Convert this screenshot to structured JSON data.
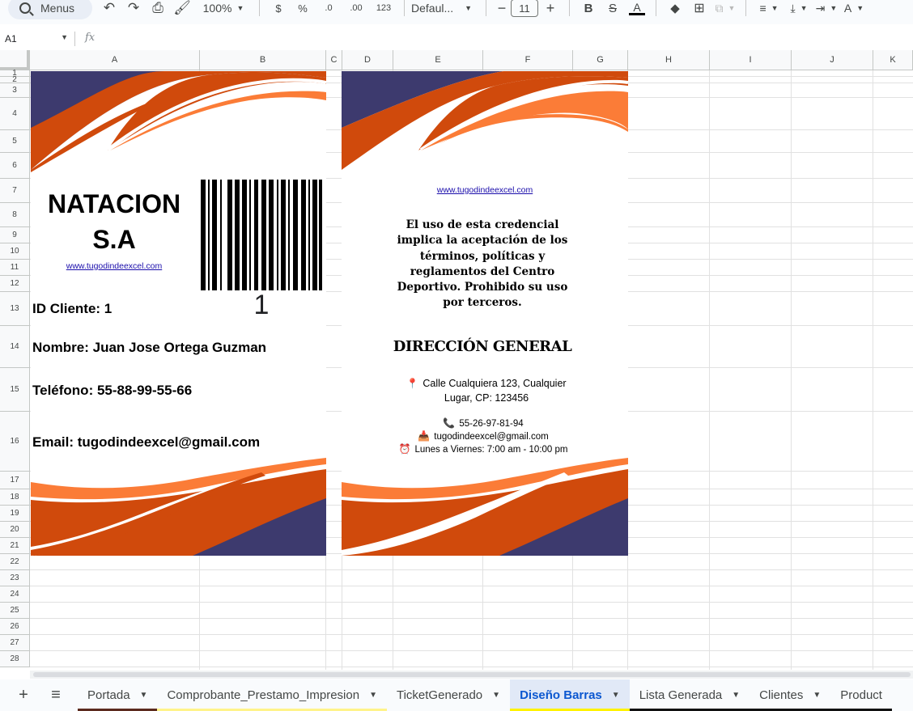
{
  "toolbar": {
    "search_label": "Menus",
    "zoom": "100%",
    "currency": "$",
    "percent": "%",
    "decrease_decimal": ".0",
    "increase_decimal": ".00",
    "number_format": "123",
    "font_name": "Defaul...",
    "font_size": "11",
    "minus": "−",
    "plus": "+",
    "bold": "B",
    "text_color_letter": "A",
    "text_color": "#000000"
  },
  "formula_bar": {
    "cell_ref": "A1",
    "fx": "fx",
    "value": ""
  },
  "columns": [
    "A",
    "B",
    "C",
    "D",
    "E",
    "F",
    "G",
    "H",
    "I",
    "J",
    "K"
  ],
  "rows": [
    "1",
    "2",
    "3",
    "4",
    "5",
    "6",
    "7",
    "8",
    "9",
    "10",
    "11",
    "12",
    "13",
    "14",
    "15",
    "16",
    "17",
    "18",
    "19",
    "20",
    "21",
    "22",
    "23",
    "24",
    "25",
    "26",
    "27",
    "28"
  ],
  "card_front": {
    "title_line1": "NATACION",
    "title_line2": "S.A",
    "link": "www.tugodindeexcel.com",
    "barcode_number": "1",
    "id_line": "ID Cliente: 1",
    "name_line": "Nombre: Juan Jose Ortega Guzman",
    "phone_line": "Teléfono: 55-88-99-55-66",
    "email_line": "Email: tugodindeexcel@gmail.com"
  },
  "card_back": {
    "link": "www.tugodindeexcel.com",
    "terms": "El uso de esta credencial implica la aceptación de los términos, políticas y reglamentos del Centro Deportivo. Prohibido su uso por terceros.",
    "heading": "DIRECCIÓN GENERAL",
    "address": "Calle Cualquiera 123, Cualquier Lugar, CP: 123456",
    "phone": "55-26-97-81-94",
    "email": "tugodindeexcel@gmail.com",
    "hours": "Lunes a Viernes: 7:00 am - 10:00 pm"
  },
  "colors": {
    "navy": "#3d3a6e",
    "orange_dark": "#d04a0c",
    "orange_light": "#fb7c37",
    "accent_tab": "#0b57d0"
  },
  "sheet_tabs": [
    {
      "label": "Portada",
      "color": "#5b2a1e"
    },
    {
      "label": "Comprobante_Prestamo_Impresion",
      "color": "#fff38a"
    },
    {
      "label": "TicketGenerado",
      "color": ""
    },
    {
      "label": "Diseño Barras",
      "color": "#fff200",
      "active": true
    },
    {
      "label": "Lista Generada",
      "color": "#111111"
    },
    {
      "label": "Clientes",
      "color": "#111111"
    },
    {
      "label": "Product",
      "color": "#111111"
    }
  ]
}
